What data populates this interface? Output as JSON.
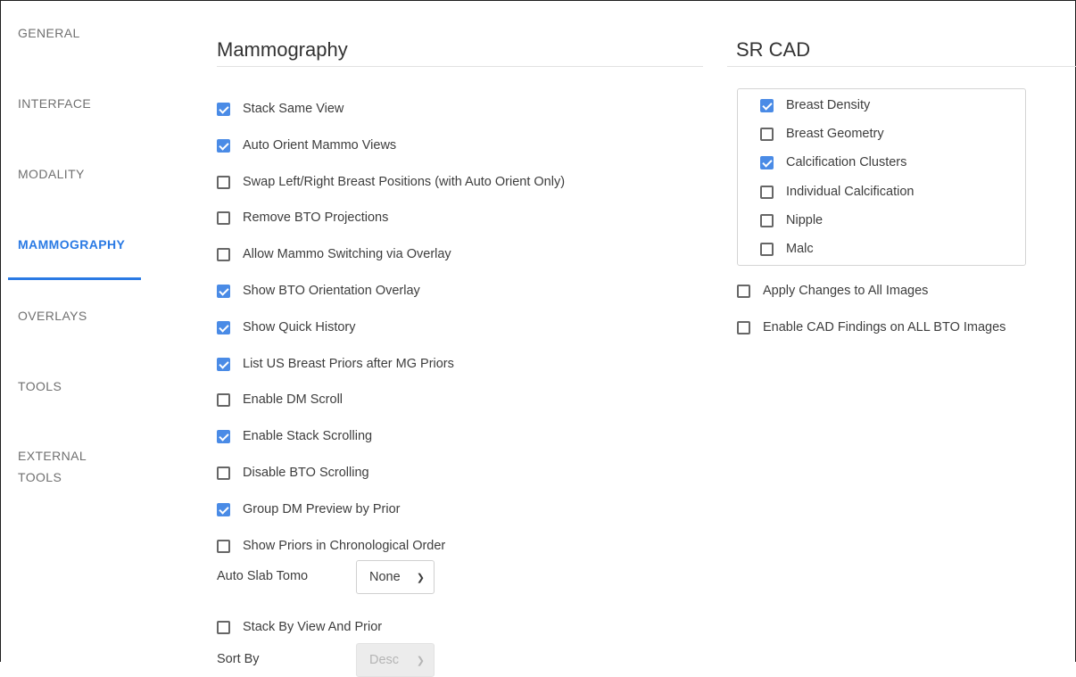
{
  "sidebar": {
    "items": [
      {
        "label": "GENERAL"
      },
      {
        "label": "INTERFACE"
      },
      {
        "label": "MODALITY"
      },
      {
        "label": "MAMMOGRAPHY"
      },
      {
        "label": "OVERLAYS"
      },
      {
        "label": "TOOLS"
      },
      {
        "label": "EXTERNAL"
      },
      {
        "label": "TOOLS"
      }
    ],
    "active": "MAMMOGRAPHY"
  },
  "mammo": {
    "title": "Mammography",
    "options": [
      {
        "label": "Stack Same View",
        "checked": true
      },
      {
        "label": "Auto Orient Mammo Views",
        "checked": true
      },
      {
        "label": "Swap Left/Right Breast Positions (with Auto Orient Only)",
        "checked": false
      },
      {
        "label": "Remove BTO Projections",
        "checked": false
      },
      {
        "label": "Allow Mammo Switching via Overlay",
        "checked": false
      },
      {
        "label": "Show BTO Orientation Overlay",
        "checked": true
      },
      {
        "label": "Show Quick History",
        "checked": true
      },
      {
        "label": "List US Breast Priors after MG Priors",
        "checked": true
      },
      {
        "label": "Enable DM Scroll",
        "checked": false
      },
      {
        "label": "Enable Stack Scrolling",
        "checked": true
      },
      {
        "label": "Disable BTO Scrolling",
        "checked": false
      },
      {
        "label": "Group DM Preview by Prior",
        "checked": true
      },
      {
        "label": "Show Priors in Chronological Order",
        "checked": false
      }
    ],
    "auto_slab": {
      "label": "Auto Slab Tomo",
      "value": "None"
    },
    "stack_by_view": {
      "label": "Stack By View And Prior",
      "checked": false
    },
    "sort_by": {
      "label": "Sort By",
      "value": "Desc"
    }
  },
  "srcad": {
    "title": "SR CAD",
    "options": [
      {
        "label": "Breast Density",
        "checked": true
      },
      {
        "label": "Breast Geometry",
        "checked": false
      },
      {
        "label": "Calcification Clusters",
        "checked": true
      },
      {
        "label": "Individual Calcification",
        "checked": false
      },
      {
        "label": "Nipple",
        "checked": false
      },
      {
        "label": "Malc",
        "checked": false
      }
    ],
    "apply_all": {
      "label": "Apply Changes to All Images",
      "checked": false
    },
    "enable_cad_bto": {
      "label": "Enable CAD Findings on ALL BTO Images",
      "checked": false
    }
  },
  "colors": {
    "accent": "#2a7ae4",
    "checkbox_checked": "#4a8be6"
  }
}
